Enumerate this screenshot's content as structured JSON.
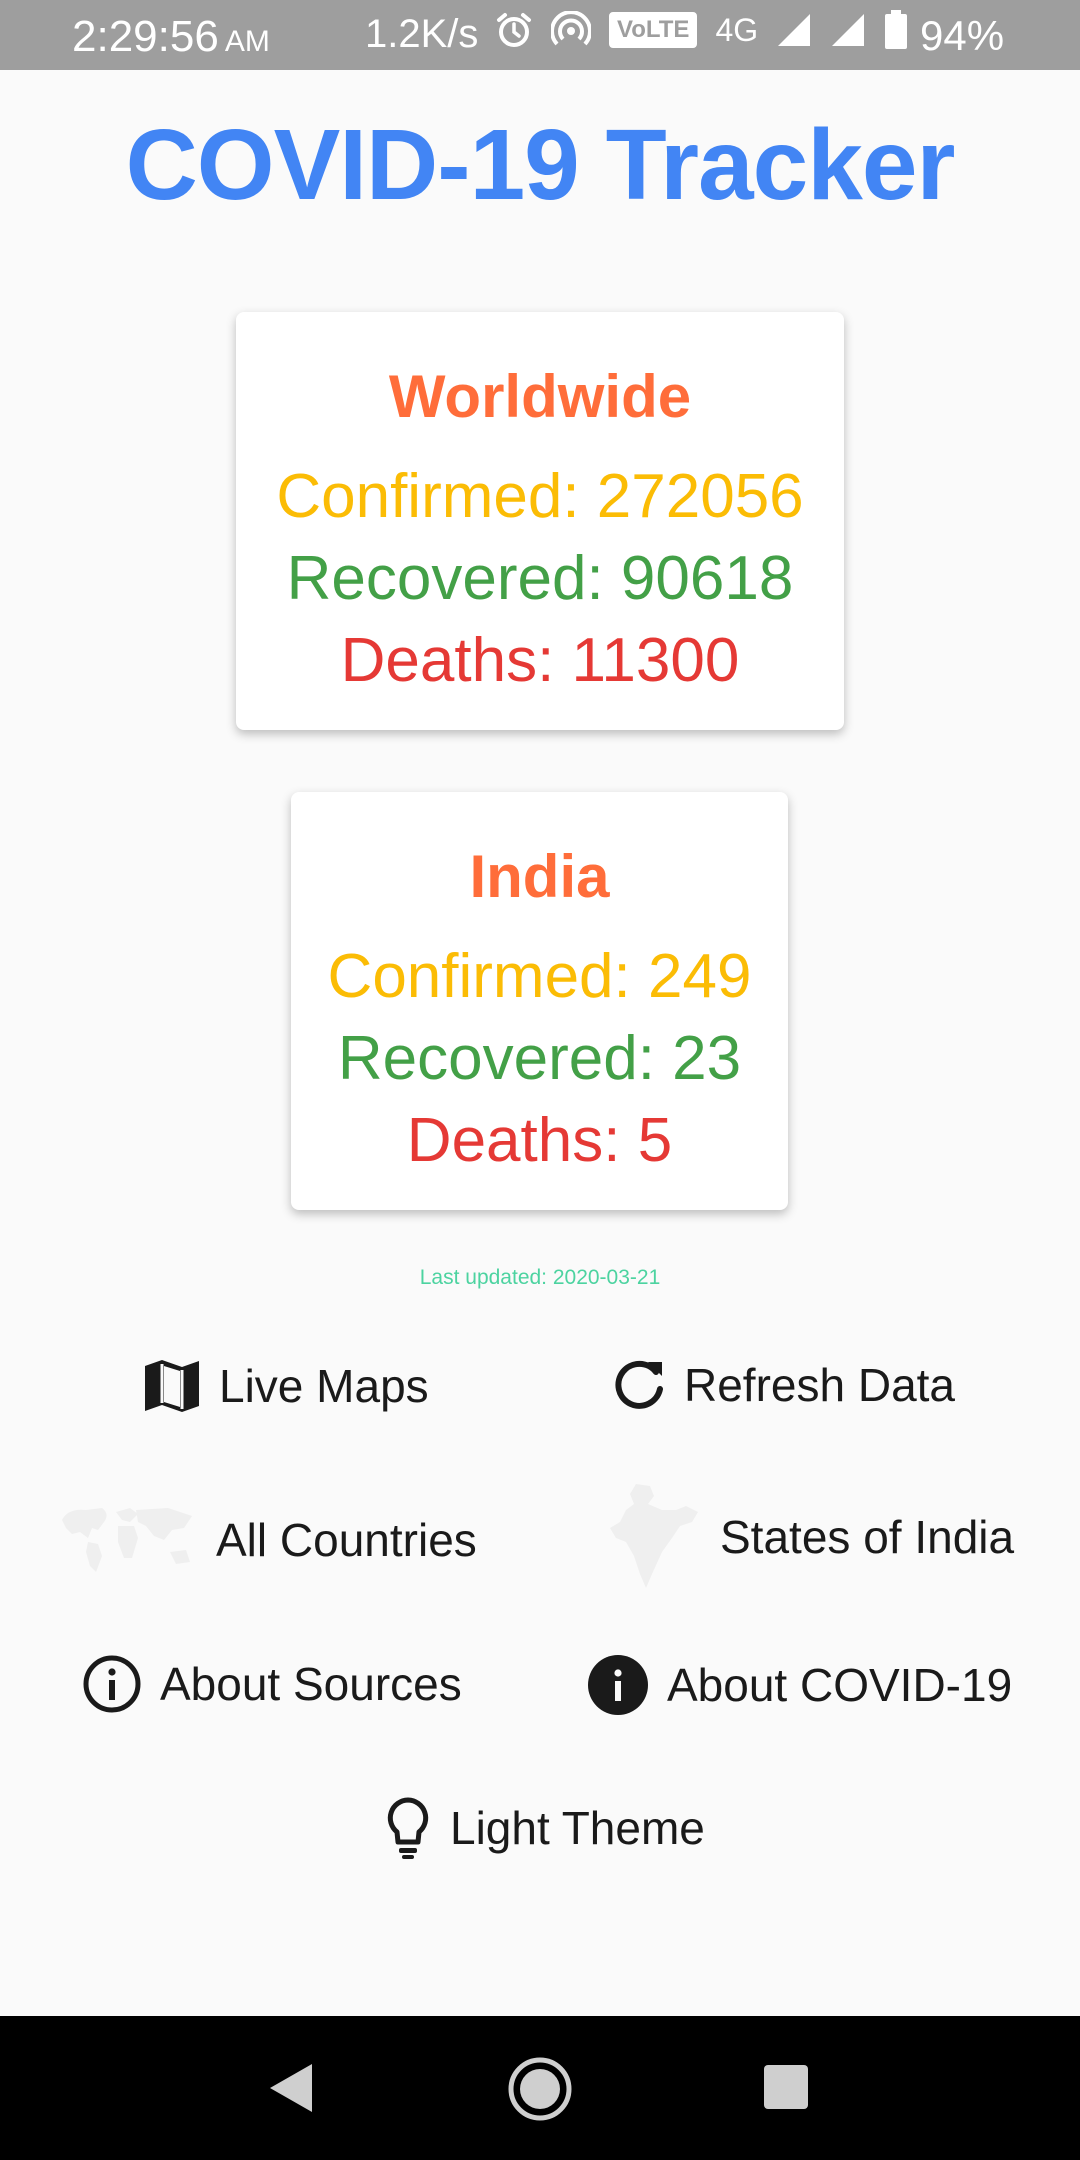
{
  "status_bar": {
    "time": "2:29:56",
    "ampm": "AM",
    "net_speed": "1.2K/s",
    "volte": "VoLTE",
    "network_type": "4G",
    "battery": "94%"
  },
  "app": {
    "title": "COVID-19 Tracker"
  },
  "worldwide": {
    "title": "Worldwide",
    "confirmed": "Confirmed: 272056",
    "recovered": "Recovered: 90618",
    "deaths": "Deaths: 11300"
  },
  "india": {
    "title": "India",
    "confirmed": "Confirmed: 249",
    "recovered": "Recovered: 23",
    "deaths": "Deaths: 5"
  },
  "last_updated": "Last updated: 2020-03-21",
  "menu": {
    "live_maps": "Live Maps",
    "refresh_data": "Refresh Data",
    "all_countries": "All Countries",
    "states_of_india": "States of India",
    "about_sources": "About Sources",
    "about_covid": "About COVID-19",
    "light_theme": "Light Theme"
  },
  "icons": {
    "live_maps": "map-icon",
    "refresh_data": "refresh-icon",
    "all_countries": "world-map-icon",
    "states_of_india": "india-map-icon",
    "about_sources": "info-outline-icon",
    "about_covid": "info-filled-icon",
    "light_theme": "lightbulb-icon"
  },
  "colors": {
    "title": "#4285f4",
    "card_title": "#ff6d3a",
    "confirmed": "#fbbc05",
    "recovered": "#43a047",
    "deaths": "#e53935",
    "last_updated": "#4cd3a0"
  }
}
